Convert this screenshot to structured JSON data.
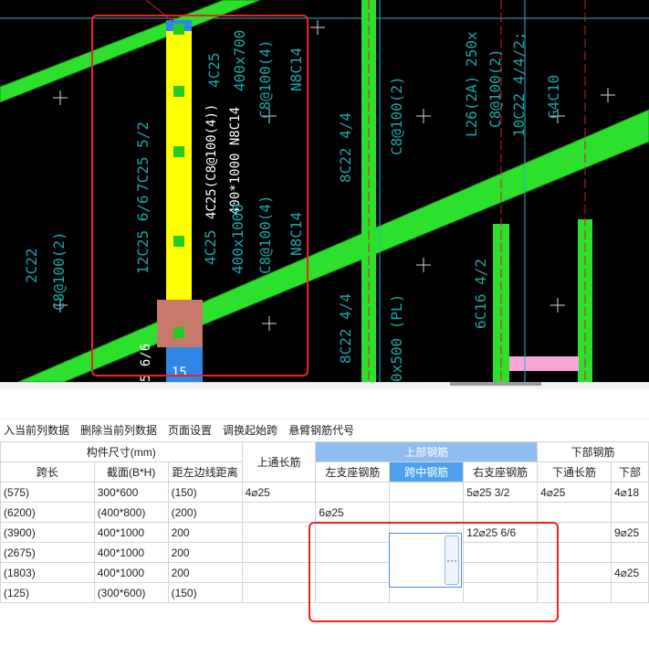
{
  "cad": {
    "left_col": {
      "label_a": "4C25",
      "label_b": "400x700",
      "label_c": "C8@100(4)",
      "label_d": "N8C14",
      "label_e": "4C25(C8@100(4))",
      "label_f": "400*1000 N8C14",
      "label_g": "12C25 6/6",
      "label_h": "7C25 5/2",
      "label_i": "4C25",
      "label_j": "400x1000",
      "label_k": "C8@100(4)",
      "label_l": "N8C14",
      "label_m": "2C22",
      "label_n": "C8@100(2)",
      "label_o": "15",
      "label_p": "5 6/6"
    },
    "mid_col": {
      "label_a": "8C22 4/4",
      "label_b": "C8@100(2)",
      "label_c": "8C22 4/4",
      "label_d": "0x500 (PL)",
      "label_e": "6C16 4/2"
    },
    "right_col": {
      "label_a": "L26(2A) 250x",
      "label_b": "C8@100(2)",
      "label_c": "10C22 4/4/2;",
      "label_d": "G4C10"
    }
  },
  "menu": {
    "insert": "入当前列数据",
    "delete": "删除当前列数据",
    "page_setup": "页面设置",
    "switch_span": "调换起始跨",
    "cantilever": "悬臂钢筋代号"
  },
  "grid": {
    "group_size": "构件尺寸(mm)",
    "col_span": "跨长",
    "col_section": "截面(B*H)",
    "col_offset": "距左边线距离",
    "col_top_through": "上通长筋",
    "group_top": "上部钢筋",
    "col_left_support": "左支座钢筋",
    "col_mid_span": "跨中钢筋",
    "col_right_support": "右支座钢筋",
    "group_bottom": "下部钢筋",
    "col_bottom_through": "下通长筋",
    "col_bottom_next": "下部",
    "rows": [
      {
        "span": "(575)",
        "section": "300*600",
        "offset": "(150)",
        "top_through": "4⌀25",
        "left": "",
        "mid": "",
        "right": "5⌀25 3/2",
        "bottom_through": "4⌀25",
        "bottom": "4⌀18"
      },
      {
        "span": "(6200)",
        "section": "(400*800)",
        "offset": "(200)",
        "top_through": "",
        "left": "6⌀25",
        "mid": "",
        "right": "",
        "bottom_through": "",
        "bottom": ""
      },
      {
        "span": "(3900)",
        "section": "400*1000",
        "offset": "200",
        "top_through": "",
        "left": "",
        "mid": "",
        "right": "12⌀25 6/6",
        "bottom_through": "",
        "bottom": "9⌀25"
      },
      {
        "span": "(2675)",
        "section": "400*1000",
        "offset": "200",
        "top_through": "",
        "left": "",
        "mid": "",
        "right": "",
        "bottom_through": "",
        "bottom": ""
      },
      {
        "span": "(1803)",
        "section": "400*1000",
        "offset": "200",
        "top_through": "",
        "left": "",
        "mid": "",
        "right": "",
        "bottom_through": "",
        "bottom": "4⌀25"
      },
      {
        "span": "(125)",
        "section": "(300*600)",
        "offset": "(150)",
        "top_through": "",
        "left": "",
        "mid": "",
        "right": "",
        "bottom_through": "",
        "bottom": ""
      }
    ],
    "ellipsis": "···"
  }
}
